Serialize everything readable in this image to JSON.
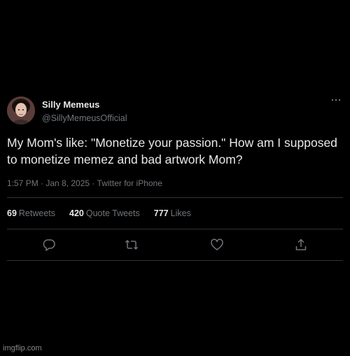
{
  "tweet": {
    "display_name": "Silly Memeus",
    "handle": "@SillyMemeusOfficial",
    "text": "My Mom's like: \"Monetize your passion.\" How am I supposed to monetize memez and bad artwork Mom?",
    "meta": "1:57 PM · Jan 8, 2025 · Twitter for iPhone",
    "stats": {
      "retweets_count": "69",
      "retweets_label": "Retweets",
      "quotes_count": "420",
      "quotes_label": "Quote Tweets",
      "likes_count": "777",
      "likes_label": "Likes"
    },
    "icons": {
      "more": "more-icon",
      "reply": "reply-icon",
      "retweet": "retweet-icon",
      "like": "heart-icon",
      "share": "share-icon"
    }
  },
  "watermark": "imgflip.com",
  "colors": {
    "background": "#000000",
    "text_primary": "#e7e9ea",
    "text_secondary": "#71767b",
    "divider": "#2f3336"
  }
}
